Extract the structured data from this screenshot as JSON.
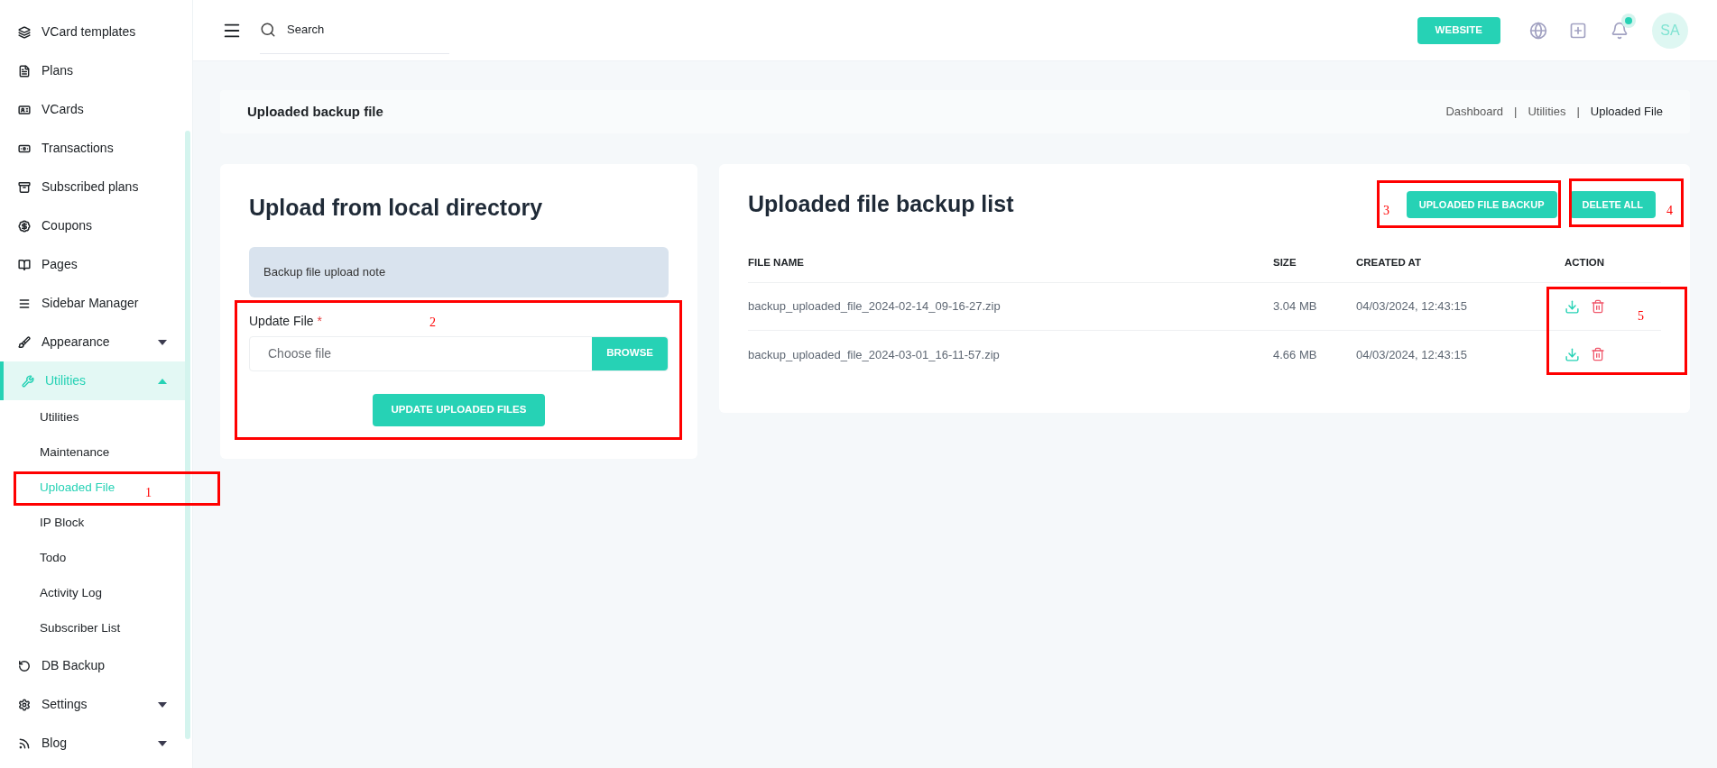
{
  "sidebar": {
    "items": [
      {
        "label": "VCard templates",
        "selected": false
      },
      {
        "label": "Plans",
        "selected": false
      },
      {
        "label": "VCards",
        "selected": false
      },
      {
        "label": "Transactions",
        "selected": false
      },
      {
        "label": "Subscribed plans",
        "selected": false
      },
      {
        "label": "Coupons",
        "selected": false
      },
      {
        "label": "Pages",
        "selected": false
      },
      {
        "label": "Sidebar Manager",
        "selected": false
      },
      {
        "label": "Appearance",
        "selected": false,
        "expanded": false
      },
      {
        "label": "Utilities",
        "selected": true,
        "expanded": true,
        "children": [
          {
            "label": "Utilities",
            "selected": false
          },
          {
            "label": "Maintenance",
            "selected": false
          },
          {
            "label": "Uploaded File",
            "selected": true
          },
          {
            "label": "IP Block",
            "selected": false
          },
          {
            "label": "Todo",
            "selected": false
          },
          {
            "label": "Activity Log",
            "selected": false
          },
          {
            "label": "Subscriber List",
            "selected": false
          }
        ]
      },
      {
        "label": "DB Backup",
        "selected": false
      },
      {
        "label": "Settings",
        "selected": false,
        "expanded": false
      },
      {
        "label": "Blog",
        "selected": false,
        "expanded": false
      }
    ]
  },
  "topbar": {
    "search": {
      "placeholder": "Search"
    },
    "website_button": "WEBSITE",
    "notification_dot": true,
    "avatar": "SA"
  },
  "page_header": {
    "title": "Uploaded backup file",
    "breadcrumbs": [
      "Dashboard",
      "Utilities",
      "Uploaded File"
    ],
    "separator": "|"
  },
  "upload_card": {
    "title": "Upload from local directory",
    "note": "Backup file upload note",
    "field_label": "Update File",
    "required_mark": "*",
    "file_placeholder": "Choose file",
    "browse_button": "BROWSE",
    "submit_button": "UPDATE UPLOADED FILES"
  },
  "list_card": {
    "title": "Uploaded file backup list",
    "buttons": [
      "UPLOADED FILE BACKUP",
      "DELETE ALL"
    ],
    "columns": [
      "FILE NAME",
      "SIZE",
      "CREATED AT",
      "ACTION"
    ],
    "rows": [
      {
        "file_name": "backup_uploaded_file_2024-02-14_09-16-27.zip",
        "size": "3.04 MB",
        "created_at": "04/03/2024, 12:43:15"
      },
      {
        "file_name": "backup_uploaded_file_2024-03-01_16-11-57.zip",
        "size": "4.66 MB",
        "created_at": "04/03/2024, 12:43:15"
      }
    ]
  },
  "annotations": [
    {
      "label": "1"
    },
    {
      "label": "2"
    },
    {
      "label": "3"
    },
    {
      "label": "4"
    },
    {
      "label": "5"
    }
  ]
}
